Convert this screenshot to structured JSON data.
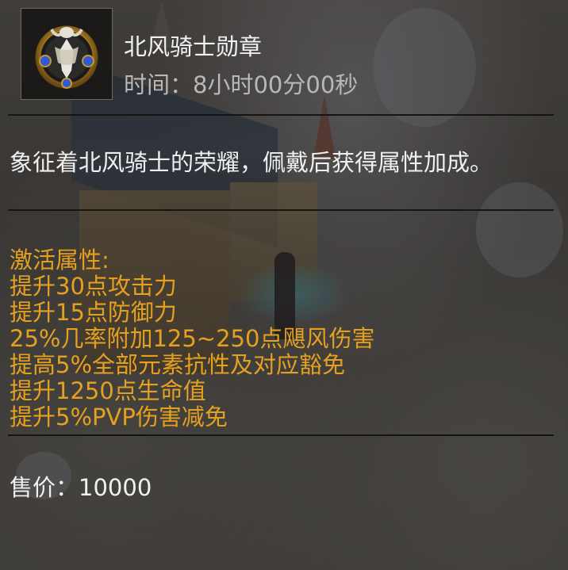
{
  "item": {
    "name": "北风骑士勋章",
    "time_label": "时间：",
    "time_value": "8小时00分00秒",
    "icon": "medal-icon"
  },
  "description": "象征着北风骑士的荣耀，佩戴后获得属性加成。",
  "attributes": {
    "header": "激活属性:",
    "lines": [
      "提升30点攻击力",
      "提升15点防御力",
      "25%几率附加125~250点飓风伤害",
      "提高5%全部元素抗性及对应豁免",
      "提升1250点生命值",
      "提升5%PVP伤害减免"
    ]
  },
  "price": {
    "label": "售价：",
    "value": "10000"
  },
  "colors": {
    "attribute_text": "#e6a020",
    "title_text": "#f2f2f2",
    "time_text": "#b8b8b8"
  }
}
